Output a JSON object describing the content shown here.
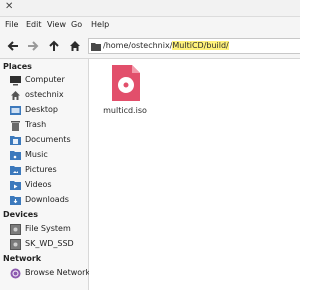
{
  "menu": [
    "File",
    "Edit",
    "View",
    "Go",
    "Help"
  ],
  "location": {
    "prefix": "/home/ostechnix/",
    "highlighted": "MultiCD/build/"
  },
  "sidebar": {
    "places_header": "Places",
    "places": [
      {
        "label": "Computer",
        "icon": "computer-icon"
      },
      {
        "label": "ostechnix",
        "icon": "home-icon"
      },
      {
        "label": "Desktop",
        "icon": "desktop-folder-icon"
      },
      {
        "label": "Trash",
        "icon": "trash-icon"
      },
      {
        "label": "Documents",
        "icon": "documents-folder-icon"
      },
      {
        "label": "Music",
        "icon": "music-folder-icon"
      },
      {
        "label": "Pictures",
        "icon": "pictures-folder-icon"
      },
      {
        "label": "Videos",
        "icon": "videos-folder-icon"
      },
      {
        "label": "Downloads",
        "icon": "downloads-folder-icon"
      }
    ],
    "devices_header": "Devices",
    "devices": [
      {
        "label": "File System",
        "icon": "drive-icon"
      },
      {
        "label": "SK_WD_SSD",
        "icon": "drive-icon"
      }
    ],
    "network_header": "Network",
    "network": [
      {
        "label": "Browse Network",
        "icon": "network-icon"
      }
    ]
  },
  "files": [
    {
      "name": "multicd.iso",
      "icon": "disc-image-icon",
      "color": "#e24f6b"
    }
  ]
}
